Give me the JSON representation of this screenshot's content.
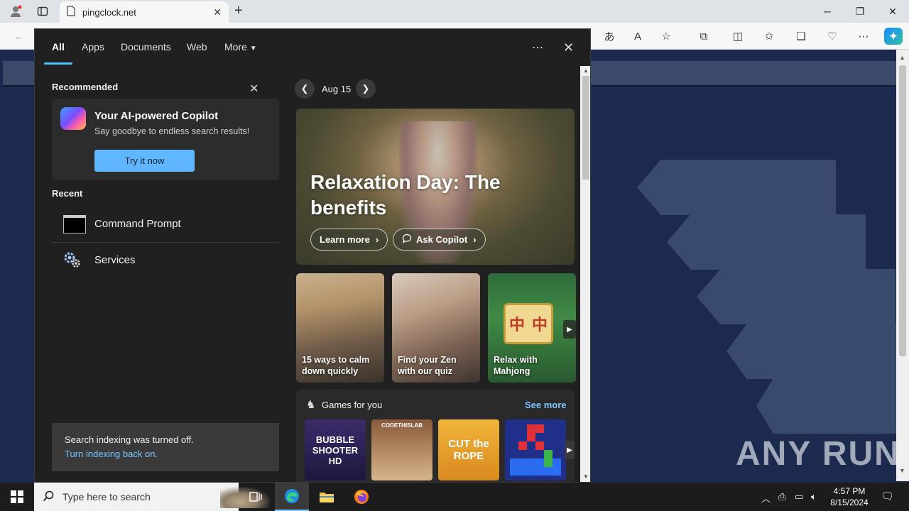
{
  "browser": {
    "tab_title": "pingclock.net"
  },
  "panel": {
    "tabs": [
      "All",
      "Apps",
      "Documents",
      "Web",
      "More"
    ],
    "recommended": {
      "heading": "Recommended",
      "card_title": "Your AI-powered Copilot",
      "card_subtitle": "Say goodbye to endless search results!",
      "card_button": "Try it now"
    },
    "recent": {
      "heading": "Recent",
      "items": [
        "Command Prompt",
        "Services"
      ]
    },
    "indexing": {
      "message": "Search indexing was turned off.",
      "link": "Turn indexing back on."
    },
    "date": "Aug 15",
    "hero": {
      "headline": "Relaxation Day: The benefits",
      "learn_more": "Learn more",
      "ask_copilot": "Ask Copilot"
    },
    "tiles": [
      "15 ways to calm down quickly",
      "Find your Zen with our quiz",
      "Relax with Mahjong"
    ],
    "games": {
      "heading": "Games for you",
      "see_more": "See more",
      "items": [
        "BUBBLE SHOOTER HD",
        "CODETHISLAB",
        "CUT the ROPE",
        ""
      ]
    }
  },
  "page": {
    "watermark": "ANY RUN"
  },
  "taskbar": {
    "search_placeholder": "Type here to search",
    "time": "4:57 PM",
    "date": "8/15/2024"
  },
  "colors": {
    "accent": "#4cc2ff",
    "link": "#7cc6ff",
    "page_bg": "#1b2a4e"
  }
}
